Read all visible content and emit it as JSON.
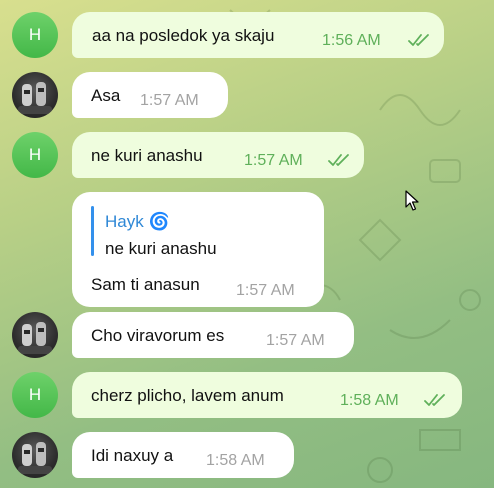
{
  "avatar_initial": "H",
  "messages": [
    {
      "text": "aa na posledok ya skaju",
      "time": "1:56 AM"
    },
    {
      "text": "Asa",
      "time": "1:57 AM"
    },
    {
      "text": "ne kuri anashu",
      "time": "1:57 AM"
    },
    {
      "text": "Sam ti anasun",
      "time": "1:57 AM",
      "reply": {
        "name": "Hayk 🌀",
        "text": "ne kuri anashu"
      }
    },
    {
      "text": "Cho viravorum es",
      "time": "1:57 AM"
    },
    {
      "text": "cherz plicho, lavem anum",
      "time": "1:58 AM"
    },
    {
      "text": "Idi naxuy a",
      "time": "1:58 AM"
    }
  ],
  "icons": {
    "read": "double-check-icon",
    "cursor": "mouse-pointer-icon"
  },
  "colors": {
    "outgoing_bubble": "#effdde",
    "incoming_bubble": "#ffffff",
    "read_check": "#5fb05a",
    "reply_accent": "#3390ec"
  }
}
